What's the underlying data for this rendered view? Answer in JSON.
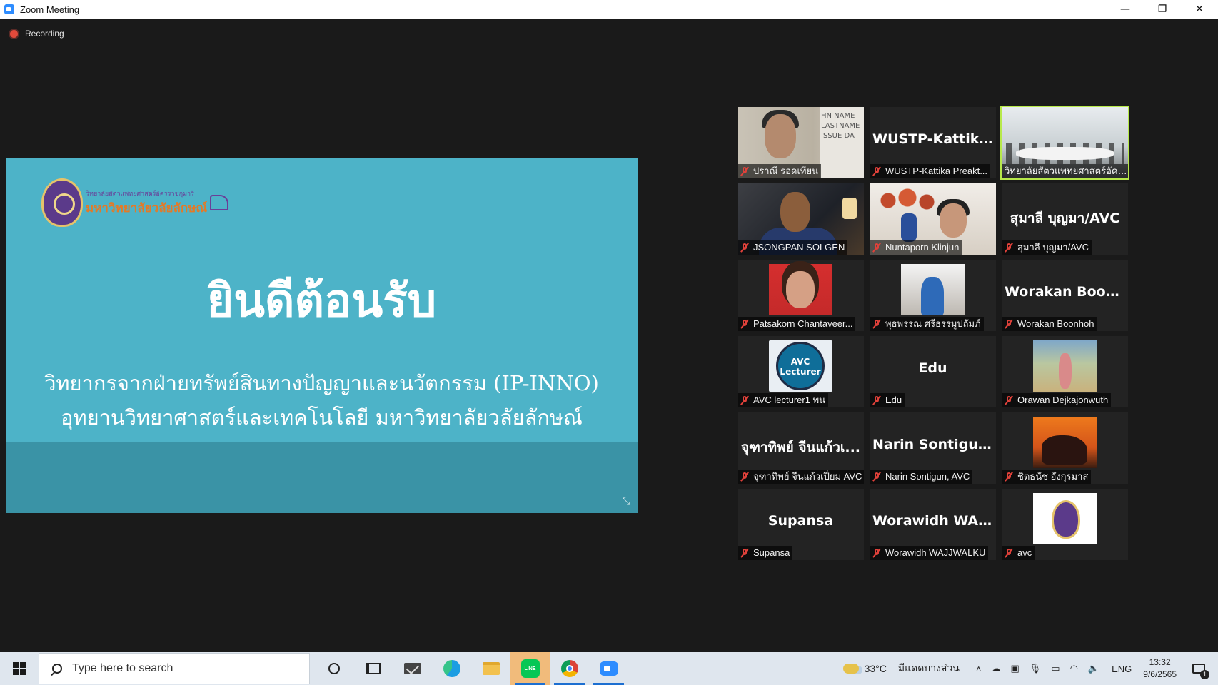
{
  "window": {
    "title": "Zoom Meeting",
    "minimize": "—",
    "restore": "❐",
    "close": "✕"
  },
  "recording": {
    "label": "Recording"
  },
  "share": {
    "logo_line1": "วิทยาลัยสัตวแพทยศาสตร์อัครราชกุมารี",
    "logo_line2": "มหาวิทยาลัยวลัยลักษณ์",
    "welcome": "ยินดีต้อนรับ",
    "line1": "วิทยากรจากฝ่ายทรัพย์สินทางปัญญาและนวัตกรรม (IP-INNO)",
    "line2": "อุทยานวิทยาศาสตร์และเทคโนโลยี มหาวิทยาลัยวลัยลักษณ์",
    "background_color": "#4db3c8"
  },
  "gallery": {
    "tiles": [
      {
        "big": "",
        "label": "ปราณี รอดเทียน",
        "board": "HN NAME LASTNAME ISSUE DA"
      },
      {
        "big": "WUSTP-Kattika...",
        "label": "WUSTP-Kattika Preakt..."
      },
      {
        "big": "",
        "label": "วิทยาลัยสัตวแพทยศาสตร์อัครร..."
      },
      {
        "big": "",
        "label": "JSONGPAN SOLGEN"
      },
      {
        "big": "",
        "label": "Nuntaporn Klinjun"
      },
      {
        "big": "สุมาลี บุญมา/AVC",
        "label": "สุมาลี บุญมา/AVC"
      },
      {
        "big": "",
        "label": "Patsakorn Chantaveer..."
      },
      {
        "big": "",
        "label": "พุธพรรณ ศรีธรรมูปถัมภ์"
      },
      {
        "big": "Worakan Boonh...",
        "label": "Worakan Boonhoh"
      },
      {
        "big": "",
        "label": "AVC lecturer1 พน",
        "thumb_line1": "AVC",
        "thumb_line2": "Lecturer"
      },
      {
        "big": "Edu",
        "label": "Edu"
      },
      {
        "big": "",
        "label": "Orawan Dejkajonwuth"
      },
      {
        "big": "จุฑาทิพย์ จีนแก้วเ...",
        "label": "จุฑาทิพย์ จีนแก้วเปี่ยม AVC"
      },
      {
        "big": "Narin Sontigun,...",
        "label": "Narin Sontigun, AVC"
      },
      {
        "big": "",
        "label": "ชิตธนัช อังกุรมาส"
      },
      {
        "big": "Supansa",
        "label": "Supansa"
      },
      {
        "big": "Worawidh WAJ...",
        "label": "Worawidh WAJJWALKU"
      },
      {
        "big": "",
        "label": "avc"
      }
    ],
    "active_speaker_color": "#b7e94a"
  },
  "taskbar": {
    "search_placeholder": "Type here to search",
    "line_icon": "LINE",
    "temp": "33°C",
    "weather": "มีแดดบางส่วน",
    "lang": "ENG",
    "time": "13:32",
    "date": "9/6/2565",
    "notification_count": "1"
  }
}
